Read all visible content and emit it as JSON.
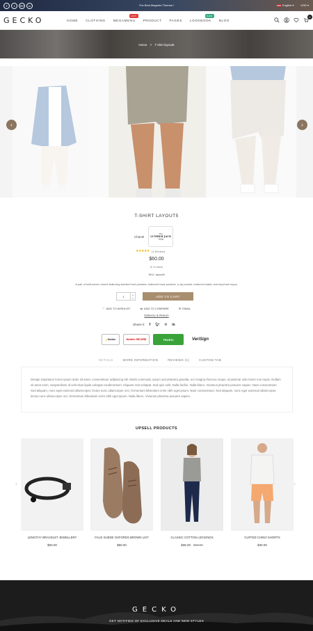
{
  "topbar": {
    "socials": [
      "f",
      "t",
      "G+",
      "o"
    ],
    "promo": "The Best Magento Themes !",
    "language": "English",
    "currency": "USD"
  },
  "header": {
    "logo": "GECKO",
    "nav": [
      {
        "label": "HOME"
      },
      {
        "label": "CLOTHING"
      },
      {
        "label": "MEGAMENU",
        "badge": "HOT",
        "badge_color": "#e23c3c"
      },
      {
        "label": "PRODUCT"
      },
      {
        "label": "PAGES"
      },
      {
        "label": "LOOKBOOK",
        "badge": "NEW",
        "badge_color": "#38a882"
      },
      {
        "label": "BLOG"
      }
    ],
    "icons": [
      "search-icon",
      "user-icon",
      "heart-icon",
      "cart-icon"
    ],
    "cart_count": "0"
  },
  "breadcrumb": {
    "home": "Home",
    "separator": ">",
    "current": "T-shirt layout5"
  },
  "product": {
    "title": "T-SHIRT LAYOUT5",
    "brand_label": "Chanel",
    "brand_logo_lines": [
      "The",
      "LUMBER JACK",
      "USA"
    ],
    "stars": "★★★★★",
    "reviews": "(1 Review)",
    "price": "$60.00",
    "stock": "In stock",
    "sku_label": "SKU:",
    "sku": "layout5",
    "description": "A pair of twill-woven shorts featuring slanted front pockets, buttoned back pockets, a zip pocket, buttoned waist, and keychain loops.",
    "qty": "1",
    "add_to_cart": "ADD TO CART",
    "wishlist": "ADD TO WISHLIST",
    "compare": "ADD TO COMPARE",
    "email": "EMAIL",
    "delivery": "Delivery & Return",
    "share_label": "Share it",
    "share_icons": [
      "facebook-icon",
      "twitter-icon",
      "pinterest-icon",
      "linkedin-icon"
    ],
    "trust_badges": [
      "Norton",
      "McAfee SECURE",
      "TRUSTe",
      "VeriSign"
    ]
  },
  "tabs": {
    "items": [
      "DETAILS",
      "MORE INFORMATION",
      "REVIEWS (1)",
      "CUSTOM TAB"
    ],
    "active": "DETAILS",
    "details_text": "Design inspiration lorem ipsum dolor sit amet, consectetuer adipiscing elit. Morbi commodo, ipsum sed pharetra gravida, orci magna rhoncus neque, id pulvinar odio lorem non turpis. Nullam sit amet enim. Suspendisse id velit vitae ligula volutpat condimentum. Aliquam erat volutpat. Sed quis velit. Nulla facilisi. Nulla libero. Vivamus pharetra posuere sapien. Nam consectetuer. Sed aliquam, nunc eget euismod ullamcorper, lectus nunc ullamcorper orci, fermentum bibendum enim nibh eget ipsum. Nam consectetuer. Sed aliquam, nunc eget euismod ullamcorper, lectus nunc ullamcorper orci, fermentum bibendum enim nibh eget ipsum. Nulla libero. Vivamus pharetra posuere sapien."
  },
  "upsell": {
    "title": "UPSELL PRODUCTS",
    "products": [
      {
        "name": "LENGTHY BRACELET JEWELLERY",
        "price": "$00.00",
        "old_price": ""
      },
      {
        "name": "FAUX SUEDE OXFORDS BROWN LIST",
        "price": "$60.00",
        "old_price": ""
      },
      {
        "name": "CLASSIC COTTON LEGGINGS",
        "price": "$35.00",
        "old_price": "$60.00"
      },
      {
        "name": "CUFFED CHINO SHORTS",
        "price": "$30.00",
        "old_price": ""
      }
    ]
  },
  "footer": {
    "logo": "GECKO",
    "newsletter_text": "GET NOTIFIED OF EXCLUSIVE DEALS AND NEW STYLES"
  },
  "colors": {
    "accent": "#a88d6f",
    "arrow": "#8b7560",
    "stars": "#f0b400"
  }
}
